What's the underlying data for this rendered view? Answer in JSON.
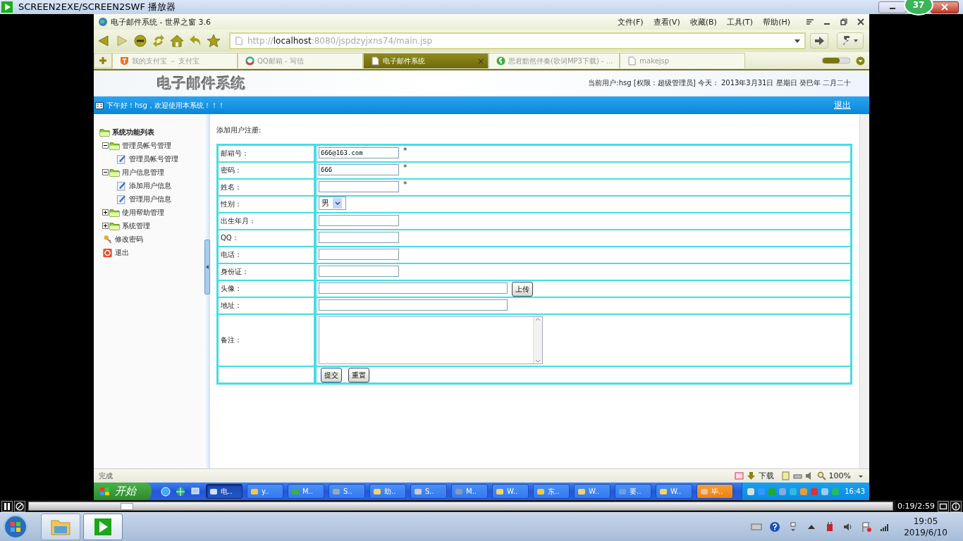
{
  "player": {
    "title": "SCREEN2EXE/SCREEN2SWF 播放器",
    "badge": "37",
    "time": "0:19/2:59",
    "level": 0.106
  },
  "browser": {
    "title": "电子邮件系统 - 世界之窗 3.6",
    "menu": [
      "文件(F)",
      "查看(V)",
      "收藏(B)",
      "工具(T)",
      "帮助(H)"
    ],
    "address": "http://**localhost**:8080/jspdzyjxns74/main.jsp",
    "tabs": [
      {
        "label": "我的支付宝 － 支付宝",
        "selected": false
      },
      {
        "label": "QQ邮箱 - 写信",
        "selected": false
      },
      {
        "label": "电子邮件系统",
        "selected": true,
        "close": "×"
      },
      {
        "label": "思君黯然伴奏(歌词MP3下载) - ...",
        "selected": false
      },
      {
        "label": "makejsp",
        "selected": false
      }
    ],
    "status": "完成",
    "download": "下载",
    "zoom": "100%"
  },
  "page": {
    "logo": "电子邮件系统",
    "user_info": "当前用户:hsg [权限：超级管理员] 今天： 2013年3月31日 星期日 癸巳年 二月二十",
    "greeting": "下午好！hsg，欢迎使用本系统！！！",
    "logout": "退出",
    "tree": {
      "label": "系统功能列表",
      "kind": "root",
      "children": [
        {
          "label": "管理员帐号管理",
          "kind": "folder",
          "expanded": true,
          "children": [
            {
              "label": "管理员帐号管理",
              "kind": "page"
            }
          ]
        },
        {
          "label": "用户信息管理",
          "kind": "folder",
          "expanded": true,
          "children": [
            {
              "label": "添加用户信息",
              "kind": "page"
            },
            {
              "label": "管理用户信息",
              "kind": "page"
            }
          ]
        },
        {
          "label": "使用帮助管理",
          "kind": "folder",
          "expanded": false
        },
        {
          "label": "系统管理",
          "kind": "folder",
          "expanded": false
        },
        {
          "label": "修改密码",
          "kind": "key"
        },
        {
          "label": "退出",
          "kind": "exit"
        }
      ]
    },
    "form": {
      "title": "添加用户注册:",
      "rows": [
        {
          "label": "邮箱号：",
          "kind": "text",
          "value": "666@163.com",
          "note": "*"
        },
        {
          "label": "密码：",
          "kind": "text",
          "value": "666",
          "note": "*"
        },
        {
          "label": "姓名：",
          "kind": "text",
          "note": "*"
        },
        {
          "label": "性别：",
          "kind": "select",
          "value": "男"
        },
        {
          "label": "出生年月：",
          "kind": "text"
        },
        {
          "label": "QQ：",
          "kind": "text"
        },
        {
          "label": "电话：",
          "kind": "text"
        },
        {
          "label": "身份证：",
          "kind": "text"
        },
        {
          "label": "头像：",
          "kind": "upload",
          "button": "上传"
        },
        {
          "label": "地址：",
          "kind": "wide"
        },
        {
          "label": "备注：",
          "kind": "textarea"
        },
        {
          "kind": "buttons",
          "buttons": [
            "提交",
            "重置"
          ]
        }
      ]
    }
  },
  "xp_taskbar": {
    "start": "开始",
    "tasks": [
      {
        "label": "电..",
        "selected": true,
        "flashing": false
      },
      {
        "label": "y..",
        "selected": false,
        "flashing": false
      },
      {
        "label": "M..",
        "selected": false,
        "flashing": false
      },
      {
        "label": "S..",
        "selected": false,
        "flashing": false
      },
      {
        "label": "助..",
        "selected": false,
        "flashing": false
      },
      {
        "label": "S..",
        "selected": false,
        "flashing": false
      },
      {
        "label": "M..",
        "selected": false,
        "flashing": false
      },
      {
        "label": "W..",
        "selected": false,
        "flashing": false
      },
      {
        "label": "东..",
        "selected": false,
        "flashing": false
      },
      {
        "label": "W..",
        "selected": false,
        "flashing": false
      },
      {
        "label": "要..",
        "selected": false,
        "flashing": false
      },
      {
        "label": "W..",
        "selected": false,
        "flashing": false
      },
      {
        "label": "毕..",
        "selected": false,
        "flashing": true
      }
    ],
    "clock": "16:43"
  },
  "win7_taskbar": {
    "time": "19:05",
    "date": "2019/6/10"
  }
}
